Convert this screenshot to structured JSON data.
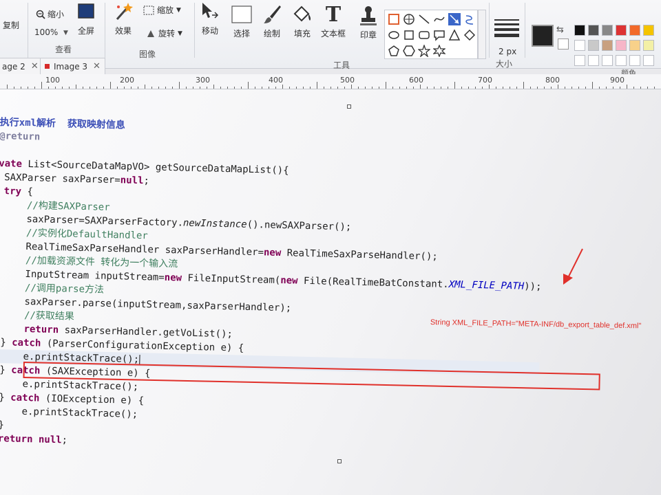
{
  "ribbon": {
    "view_group": {
      "label": "查看",
      "zoom_out": "缩小",
      "zoom_level": "100%",
      "fullscreen": "全屏"
    },
    "clipboard": {
      "copy": "复制"
    },
    "image_group": {
      "label": "图像",
      "effects": "效果",
      "resize": "缩放",
      "rotate": "旋转"
    },
    "tools_group": {
      "label": "工具",
      "move": "移动",
      "select": "选择",
      "draw": "绘制",
      "fill": "填充",
      "text": "文本框",
      "stamp": "印章"
    },
    "size_group": {
      "label": "大小",
      "value": "2 px"
    },
    "colors_group": {
      "label": "颜色"
    }
  },
  "tabs": [
    {
      "label": "age 2"
    },
    {
      "label": "Image 3"
    }
  ],
  "ruler": {
    "labels": [
      "100",
      "200",
      "300",
      "400",
      "500",
      "600",
      "700",
      "800",
      "900"
    ]
  },
  "code": {
    "l1_comment": "执行xml解析  获取映射信息",
    "l2_tag": "@return",
    "l4_kw": "vate",
    "l4_rest": " List<SourceDataMapVO> getSourceDataMapList(){",
    "l5_type": " SAXParser saxParser=",
    "l5_null": "null",
    "l5_end": ";",
    "l6_kw": " try",
    "l6_rest": " {",
    "l7_comment": "     //构建SAXParser",
    "l8_pre": "     saxParser=SAXParserFactory.",
    "l8_it": "newInstance",
    "l8_post": "().newSAXParser();",
    "l9_comment": "     //实例化DefaultHandler",
    "l10_pre": "     RealTimeSaxParseHandler saxParserHandler=",
    "l10_kw": "new",
    "l10_post": " RealTimeSaxParseHandler();",
    "l11_comment": "     //加载资源文件 转化为一个输入流",
    "l12_pre": "     InputStream inputStream=",
    "l12_kw1": "new",
    "l12_mid1": " FileInputStream(",
    "l12_kw2": "new",
    "l12_mid2": " File(RealTimeBatConstant.",
    "l12_const": "XML_FILE_PATH",
    "l12_post": "));",
    "l13_comment": "     //调用parse方法",
    "l14": "     saxParser.parse(inputStream,saxParserHandler);",
    "l15_comment": "     //获取结果",
    "l16_kw": "     return",
    "l16_rest": " saxParserHandler.getVoList();",
    "l17_pre": " } ",
    "l17_kw": "catch",
    "l17_post": " (ParserConfigurationException e) {",
    "l18": "     e.printStackTrace();",
    "l19_pre": " } ",
    "l19_kw": "catch",
    "l19_post": " (SAXException e) {",
    "l20": "     e.printStackTrace();",
    "l21_pre": " } ",
    "l21_kw": "catch",
    "l21_post": " (IOException e) {",
    "l22": "     e.printStackTrace();",
    "l23": " }",
    "l24_kw": " return",
    "l24_null": " null",
    "l24_end": ";"
  },
  "annotation": {
    "text": "String XML_FILE_PATH=\"META-INF/db_export_table_def.xml\""
  },
  "colors": {
    "highlight": "#e0302a",
    "selected_tool": "#3a66c8",
    "primary_color": "#222222"
  }
}
